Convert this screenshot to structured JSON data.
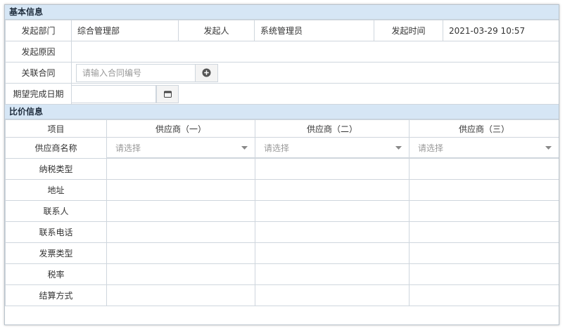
{
  "basic": {
    "title": "基本信息",
    "dept_label": "发起部门",
    "dept_value": "综合管理部",
    "initiator_label": "发起人",
    "initiator_value": "系统管理员",
    "time_label": "发起时间",
    "time_value": "2021-03-29 10:57",
    "reason_label": "发起原因",
    "reason_value": "",
    "contract_label": "关联合同",
    "contract_placeholder": "请输入合同编号",
    "due_label": "期望完成日期",
    "due_value": ""
  },
  "compare": {
    "title": "比价信息",
    "item_header": "项目",
    "suppliers": [
      "供应商（一）",
      "供应商（二）",
      "供应商（三）"
    ],
    "select_placeholder": "请选择",
    "rows": [
      "供应商名称",
      "纳税类型",
      "地址",
      "联系人",
      "联系电话",
      "发票类型",
      "税率",
      "结算方式"
    ]
  },
  "icons": {
    "add": "plus-circle-icon",
    "calendar": "calendar-icon",
    "dropdown": "caret-down-icon"
  }
}
